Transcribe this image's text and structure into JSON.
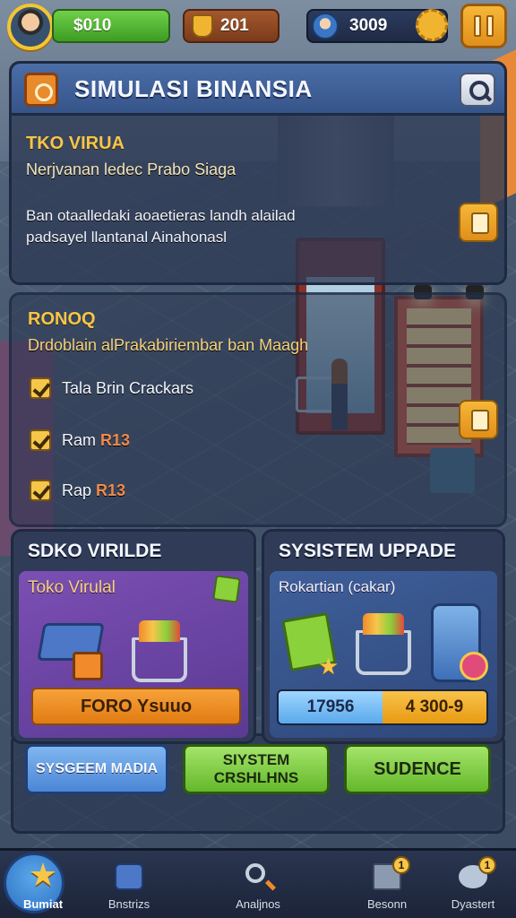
{
  "top_bar": {
    "money": "$010",
    "trophies": "201",
    "gems": "3009"
  },
  "main_panel": {
    "title": "SIMULASI BINANSIA",
    "section_heading": "TKO VIRUA",
    "section_sub": "Nerjvanan ledec Prabo Siaga",
    "body_line1": "Ban otaalledaki aoaetieras landh alailad",
    "body_line2": "padsayel llantanal Ainahonasl"
  },
  "tasks_panel": {
    "heading": "RONOQ",
    "subheading": "Drdoblain alPrakabiriembar ban Maagh",
    "tasks": [
      {
        "label": "Tala Brin Crackars",
        "accent": ""
      },
      {
        "label": "Ram",
        "accent": "R13"
      },
      {
        "label": "Rap",
        "accent": "R13"
      }
    ]
  },
  "card_left": {
    "title": "SDKO VIRILDE",
    "subtitle": "Toko Virulal",
    "button": "FORO Ysuuo"
  },
  "card_right": {
    "title": "SYSISTEM UPPADE",
    "subtitle": "Rokartian (cakar)",
    "progress_left": "17956",
    "progress_right": "4 300-9"
  },
  "actions": {
    "blue_btn": "SYSGEEM MADIA",
    "green_btn1": "SIYSTEM CRSHLHNS",
    "green_btn2": "SUDENCE"
  },
  "nav": {
    "items": [
      {
        "label": "Bumiat",
        "icon": "star-icon"
      },
      {
        "label": "Bnstrizs",
        "icon": "store-icon"
      },
      {
        "label": "Analjnos",
        "icon": "magnifier-icon"
      },
      {
        "label": "Besonn",
        "icon": "board-icon",
        "badge": "1"
      },
      {
        "label": "Dyastert",
        "icon": "chat-icon",
        "badge": "1"
      }
    ]
  },
  "colors": {
    "accent_orange": "#f08a2a",
    "accent_green": "#64b82a",
    "accent_blue": "#4c86d6",
    "heading_yellow": "#f6c64a"
  }
}
